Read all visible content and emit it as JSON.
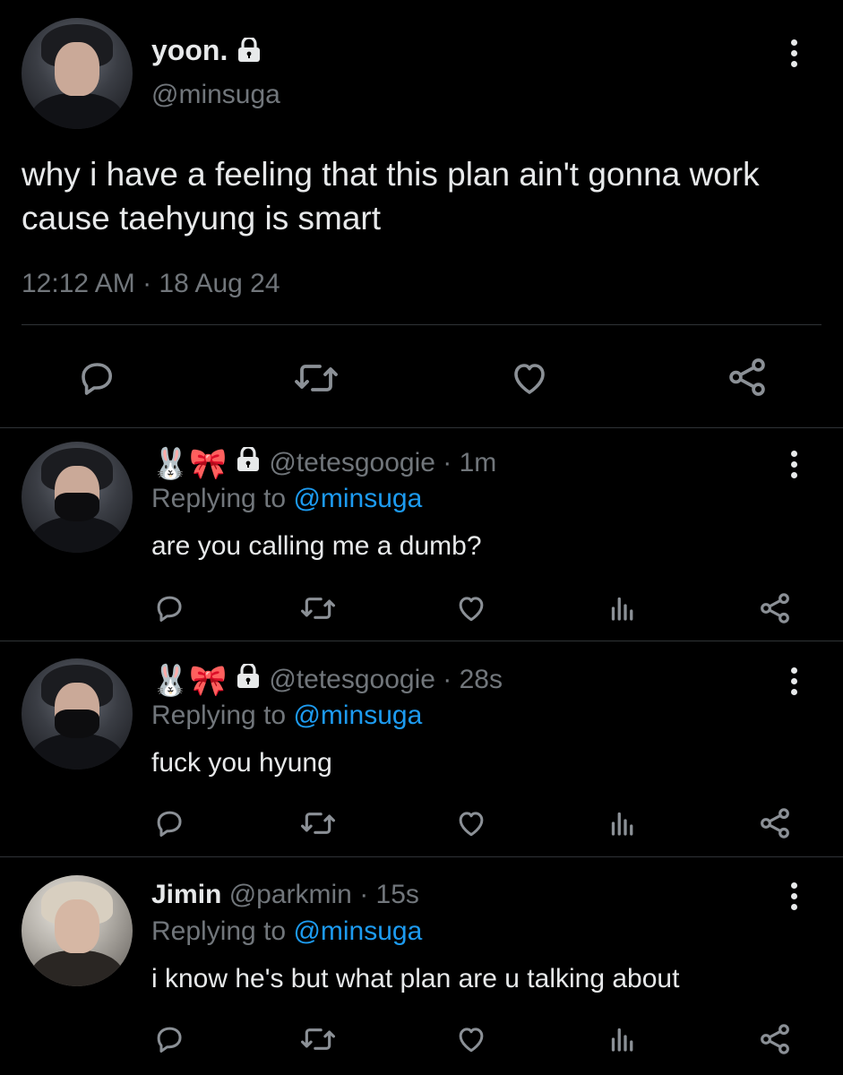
{
  "main_tweet": {
    "display_name": "yoon.",
    "handle": "@minsuga",
    "text": "why i have a feeling that this plan ain't gonna work cause taehyung is smart",
    "timestamp": "12:12 AM · 18 Aug 24",
    "actions": [
      "reply-icon",
      "retweet-icon",
      "like-icon",
      "share-icon"
    ]
  },
  "replies": [
    {
      "name_emojis": "🐰🎀",
      "handle": "@tetesgoogie",
      "time": "· 1m",
      "replying_prefix": "Replying to",
      "replying_to": "@minsuga",
      "text": "are you calling me a dumb?"
    },
    {
      "name_emojis": "🐰🎀",
      "handle": "@tetesgoogie",
      "time": "· 28s",
      "replying_prefix": "Replying to",
      "replying_to": "@minsuga",
      "text": "fuck you hyung"
    },
    {
      "display_name": "Jimin",
      "handle": "@parkmin",
      "time": "· 15s",
      "replying_prefix": "Replying to",
      "replying_to": "@minsuga",
      "text": "i know he's but what plan are u talking about"
    }
  ],
  "colors": {
    "background": "#000000",
    "text": "#e7e9ea",
    "muted": "#71767b",
    "link": "#1d9bf0",
    "divider": "#2f3336"
  }
}
